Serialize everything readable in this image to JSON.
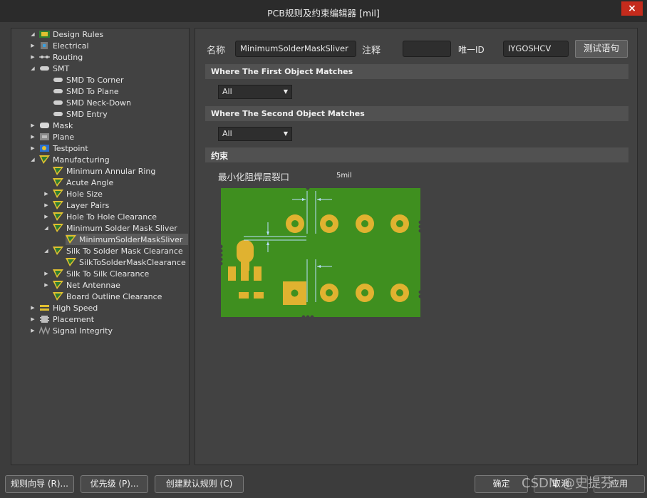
{
  "window": {
    "title": "PCB规则及约束编辑器 [mil]",
    "close_glyph": "×"
  },
  "tree": [
    {
      "label": "Design Rules",
      "icon": "design-rules-icon",
      "expanded": true
    },
    {
      "label": "Electrical",
      "icon": "electrical-icon",
      "expanded": false
    },
    {
      "label": "Routing",
      "icon": "routing-icon",
      "expanded": false
    },
    {
      "label": "SMT",
      "icon": "smt-icon",
      "expanded": true
    },
    {
      "label": "SMD To Corner",
      "icon": "smd-rule-icon"
    },
    {
      "label": "SMD To Plane",
      "icon": "smd-rule-icon"
    },
    {
      "label": "SMD Neck-Down",
      "icon": "smd-rule-icon"
    },
    {
      "label": "SMD Entry",
      "icon": "smd-rule-icon"
    },
    {
      "label": "Mask",
      "icon": "mask-icon",
      "expanded": false
    },
    {
      "label": "Plane",
      "icon": "plane-icon",
      "expanded": false
    },
    {
      "label": "Testpoint",
      "icon": "testpoint-icon",
      "expanded": false
    },
    {
      "label": "Manufacturing",
      "icon": "manufacturing-icon",
      "expanded": true
    },
    {
      "label": "Minimum Annular Ring",
      "icon": "manufacturing-rule-icon"
    },
    {
      "label": "Acute Angle",
      "icon": "manufacturing-rule-icon"
    },
    {
      "label": "Hole Size",
      "icon": "manufacturing-rule-icon",
      "expanded": false
    },
    {
      "label": "Layer Pairs",
      "icon": "manufacturing-rule-icon",
      "expanded": false
    },
    {
      "label": "Hole To Hole Clearance",
      "icon": "manufacturing-rule-icon",
      "expanded": false
    },
    {
      "label": "Minimum Solder Mask Sliver",
      "icon": "manufacturing-rule-icon",
      "expanded": true
    },
    {
      "label": "MinimumSolderMaskSliver",
      "icon": "manufacturing-rule-icon",
      "selected": true
    },
    {
      "label": "Silk To Solder Mask Clearance",
      "icon": "manufacturing-rule-icon",
      "expanded": true
    },
    {
      "label": "SilkToSolderMaskClearance",
      "icon": "manufacturing-rule-icon"
    },
    {
      "label": "Silk To Silk Clearance",
      "icon": "manufacturing-rule-icon",
      "expanded": false
    },
    {
      "label": "Net Antennae",
      "icon": "manufacturing-rule-icon",
      "expanded": false
    },
    {
      "label": "Board Outline Clearance",
      "icon": "manufacturing-rule-icon"
    },
    {
      "label": "High Speed",
      "icon": "high-speed-icon",
      "expanded": false
    },
    {
      "label": "Placement",
      "icon": "placement-icon",
      "expanded": false
    },
    {
      "label": "Signal Integrity",
      "icon": "signal-integrity-icon",
      "expanded": false
    }
  ],
  "form": {
    "name_label": "名称",
    "name_value": "MinimumSolderMaskSliver",
    "comment_label": "注释",
    "comment_value": "",
    "uid_label": "唯一ID",
    "uid_value": "IYGOSHCV",
    "test_button": "测试语句"
  },
  "first_match": {
    "heading": "Where The First Object Matches",
    "selected": "All"
  },
  "second_match": {
    "heading": "Where The Second Object Matches",
    "selected": "All"
  },
  "constraints": {
    "heading": "约束",
    "param_label": "最小化阻焊层裂口",
    "param_value": "5mil"
  },
  "colors": {
    "board": "#3f8f1f",
    "pad": "#e0b230",
    "dimension_line": "#b8e0ff"
  },
  "bottom_buttons": {
    "rule_wizard": "规则向导 (R)...",
    "priorities": "优先级 (P)...",
    "create_default": "创建默认规则 (C)",
    "ok": "确定",
    "cancel": "取消",
    "apply": "应用"
  },
  "watermark": "CSDN @史提芬"
}
